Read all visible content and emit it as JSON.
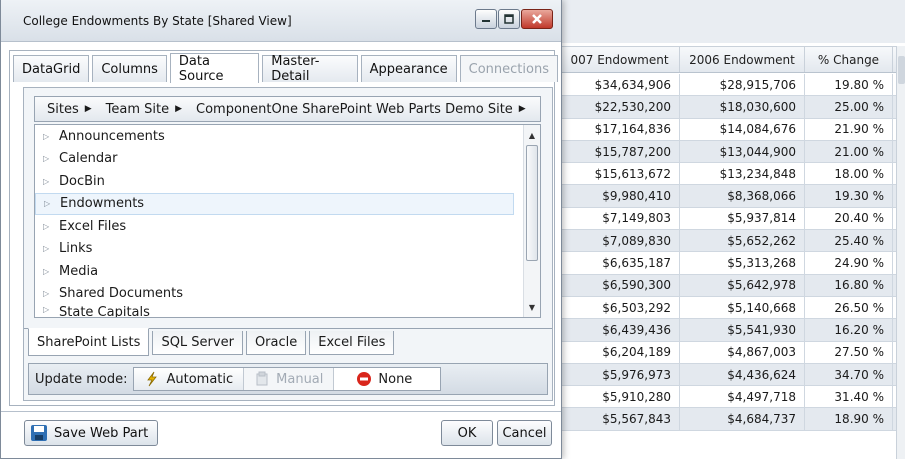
{
  "window": {
    "title": "College Endowments By State [Shared View]"
  },
  "grid": {
    "columns": [
      "007 Endowment",
      "2006 Endowment",
      "% Change"
    ],
    "rows": [
      [
        "$34,634,906",
        "$28,915,706",
        "19.80 %"
      ],
      [
        "$22,530,200",
        "$18,030,600",
        "25.00 %"
      ],
      [
        "$17,164,836",
        "$14,084,676",
        "21.90 %"
      ],
      [
        "$15,787,200",
        "$13,044,900",
        "21.00 %"
      ],
      [
        "$15,613,672",
        "$13,234,848",
        "18.00 %"
      ],
      [
        "$9,980,410",
        "$8,368,066",
        "19.30 %"
      ],
      [
        "$7,149,803",
        "$5,937,814",
        "20.40 %"
      ],
      [
        "$7,089,830",
        "$5,652,262",
        "25.40 %"
      ],
      [
        "$6,635,187",
        "$5,313,268",
        "24.90 %"
      ],
      [
        "$6,590,300",
        "$5,642,978",
        "16.80 %"
      ],
      [
        "$6,503,292",
        "$5,140,668",
        "26.50 %"
      ],
      [
        "$6,439,436",
        "$5,541,930",
        "16.20 %"
      ],
      [
        "$6,204,189",
        "$4,867,003",
        "27.50 %"
      ],
      [
        "$5,976,973",
        "$4,436,624",
        "34.70 %"
      ],
      [
        "$5,910,280",
        "$4,497,718",
        "31.40 %"
      ],
      [
        "$5,567,843",
        "$4,684,737",
        "18.90 %"
      ]
    ]
  },
  "tabs": [
    {
      "label": "DataGrid",
      "state": "normal"
    },
    {
      "label": "Columns",
      "state": "normal"
    },
    {
      "label": "Data Source",
      "state": "active"
    },
    {
      "label": "Master-Detail",
      "state": "normal"
    },
    {
      "label": "Appearance",
      "state": "normal"
    },
    {
      "label": "Connections",
      "state": "disabled"
    }
  ],
  "breadcrumb": [
    "Sites",
    "Team Site",
    "ComponentOne SharePoint Web Parts Demo Site"
  ],
  "tree": {
    "items": [
      "Announcements",
      "Calendar",
      "DocBin",
      "Endowments",
      "Excel Files",
      "Links",
      "Media",
      "Shared Documents",
      "State Capitals"
    ],
    "selected": "Endowments"
  },
  "source_tabs": [
    {
      "label": "SharePoint Lists",
      "state": "active"
    },
    {
      "label": "SQL Server",
      "state": "normal"
    },
    {
      "label": "Oracle",
      "state": "normal"
    },
    {
      "label": "Excel Files",
      "state": "normal"
    }
  ],
  "update_mode": {
    "label": "Update mode:",
    "automatic": "Automatic",
    "manual": "Manual",
    "none": "None"
  },
  "footer": {
    "save": "Save Web Part",
    "ok": "OK",
    "cancel": "Cancel"
  },
  "colors": {
    "accent_blue": "#2f6fb3",
    "selection": "#eef5fc",
    "none_red": "#d9261c",
    "lightning": "#e8b400"
  }
}
